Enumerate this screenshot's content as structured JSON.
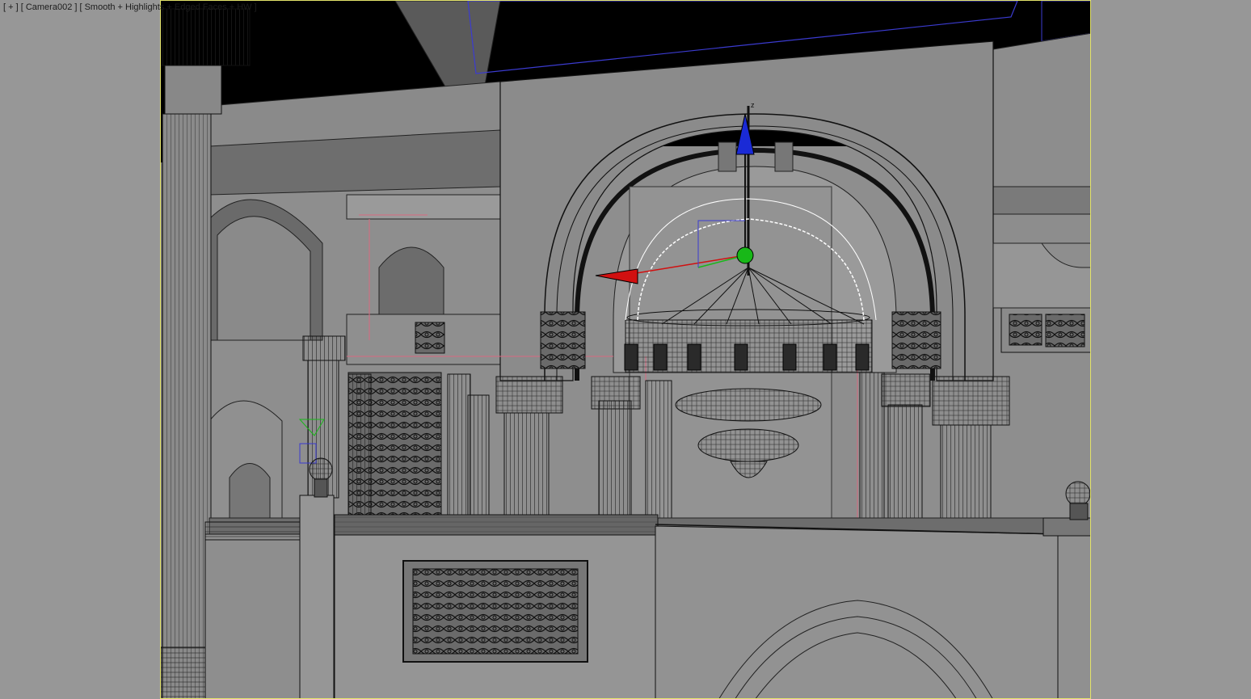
{
  "viewport": {
    "label_plus": "[ + ]",
    "label_camera": "[ Camera002 ]",
    "label_shading": "[ Smooth + Highlights + Edged Faces + HW ]"
  },
  "colors": {
    "background": "#979797",
    "frame_border": "#e3e36a",
    "ceiling": "#000000",
    "wall": "#8e8e8e",
    "gizmo_z": "#1a2ad6",
    "gizmo_x": "#d11010",
    "gizmo_y": "#18b818",
    "selection": "#ffffff"
  },
  "scene": {
    "object": "chandelier",
    "gizmo": "move-transform-gizmo",
    "gizmo_axis_label": "z"
  }
}
